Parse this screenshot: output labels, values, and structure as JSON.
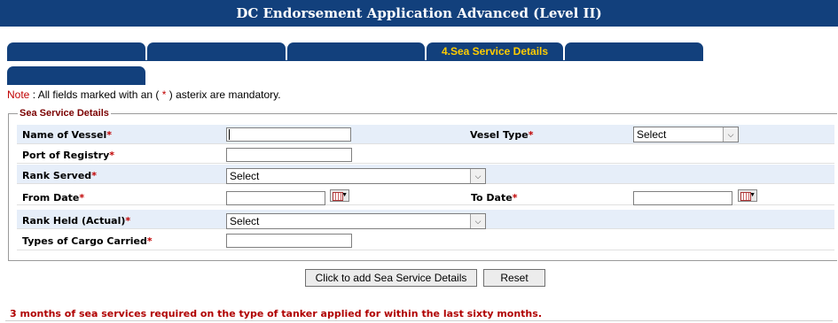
{
  "title": "DC Endorsement Application Advanced (Level II)",
  "tabs": [
    "",
    "",
    "",
    "4.Sea Service Details",
    "",
    ""
  ],
  "note": {
    "label": "Note",
    "text_before": " : All fields marked with an ( ",
    "star": "*",
    "text_after": " ) asterix are mandatory."
  },
  "section_title": "Sea Service Details",
  "required_mark": "*",
  "fields": {
    "name_of_vessel": "Name of Vessel",
    "vessel_type": "Vesel Type",
    "port_of_registry": "Port of Registry",
    "rank_served": "Rank Served",
    "from_date": "From Date",
    "to_date": "To Date",
    "rank_held": "Rank Held (Actual)",
    "types_of_cargo": "Types of Cargo Carried"
  },
  "values": {
    "name_of_vessel": "",
    "vessel_type": "Select",
    "port_of_registry": "",
    "rank_served": "Select",
    "from_date": "",
    "to_date": "",
    "rank_held": "Select",
    "types_of_cargo": ""
  },
  "icons": {
    "dropdown": "chevron-down-icon",
    "calendar": "calendar-icon"
  },
  "buttons": {
    "add": "Click to add Sea Service Details",
    "reset": "Reset"
  },
  "footer_message": "3 months of sea services required on the type of tanker applied for within the last sixty months.",
  "colors": {
    "header_bg": "#12407c",
    "tab_text": "#ffcc00",
    "required": "#c00000",
    "row_shade": "#e6eef9"
  }
}
